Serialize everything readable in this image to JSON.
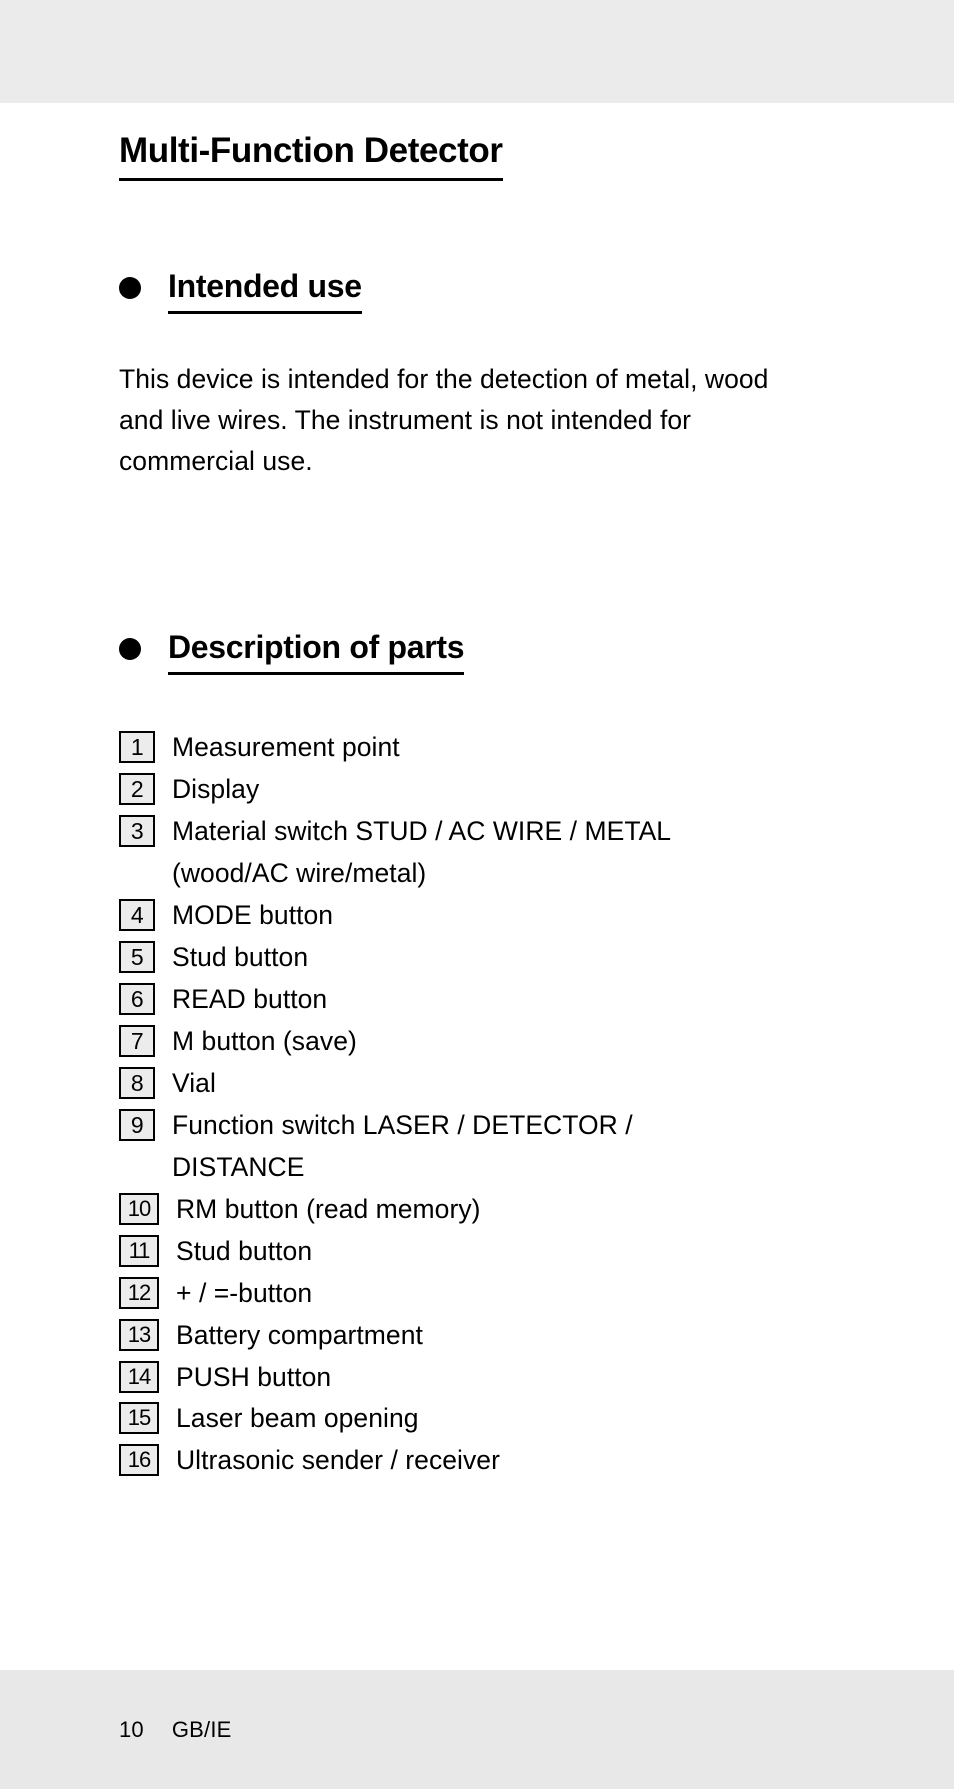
{
  "page": {
    "title": "Multi-Function Detector",
    "background_color": "#ffffff",
    "band_color": "#ebebeb"
  },
  "sections": {
    "intended_use": {
      "heading": "Intended use",
      "bullet": "filled-circle-bullet",
      "paragraph": "This device is intended for the detection of metal, wood and live wires. The instrument is not intended for commercial use."
    },
    "description_of_parts": {
      "heading": "Description of parts",
      "bullet": "filled-circle-bullet",
      "items": [
        {
          "number": "1",
          "label": "Measurement point"
        },
        {
          "number": "2",
          "label": "Display"
        },
        {
          "number": "3",
          "label": "Material switch STUD / AC WIRE / METAL",
          "continuation": "(wood/AC wire/metal)"
        },
        {
          "number": "4",
          "label": "MODE button"
        },
        {
          "number": "5",
          "label": "Stud button"
        },
        {
          "number": "6",
          "label": "READ button"
        },
        {
          "number": "7",
          "label": "M button (save)"
        },
        {
          "number": "8",
          "label": "Vial"
        },
        {
          "number": "9",
          "label": "Function switch LASER / DETECTOR /",
          "continuation": "DISTANCE"
        },
        {
          "number": "10",
          "label": "RM button (read memory)"
        },
        {
          "number": "11",
          "label": "Stud button"
        },
        {
          "number": "12",
          "label": "+ / =-button"
        },
        {
          "number": "13",
          "label": "Battery compartment"
        },
        {
          "number": "14",
          "label": "PUSH button"
        },
        {
          "number": "15",
          "label": "Laser beam opening"
        },
        {
          "number": "16",
          "label": "Ultrasonic sender / receiver"
        }
      ]
    }
  },
  "footer": {
    "page_number": "10",
    "locale": "GB/IE"
  }
}
